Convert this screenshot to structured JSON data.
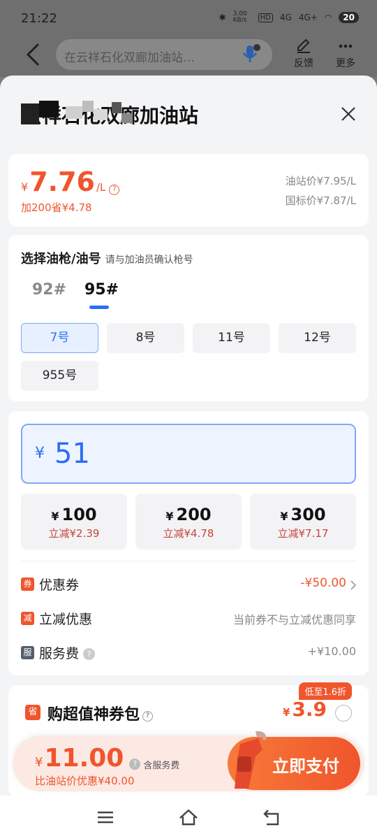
{
  "status": {
    "time": "21:22",
    "net_speed": "3.00 KB/s",
    "hd": "HD",
    "signal1": "4G",
    "signal2": "4G+",
    "battery": "20"
  },
  "header": {
    "search_text": "在云祥石化双廊加油站…",
    "feedback_label": "反馈",
    "more_label": "更多"
  },
  "station": {
    "name": "云祥石化双廊加油站"
  },
  "price": {
    "currency": "¥",
    "value": "7.76",
    "unit": "/L",
    "help": "?",
    "saving_note": "加200省¥4.78",
    "station_price": "油站价¥7.95/L",
    "national_price": "国标价¥7.87/L"
  },
  "gun": {
    "title": "选择油枪/油号",
    "hint": "请与加油员确认枪号",
    "oil_types": [
      "92#",
      "95#"
    ],
    "selected_oil": "95#",
    "guns": [
      "7号",
      "8号",
      "11号",
      "12号",
      "955号"
    ],
    "selected_gun": "7号"
  },
  "amount": {
    "currency": "¥",
    "value": "51",
    "quick": [
      {
        "amount": "100",
        "discount": "立减¥2.39"
      },
      {
        "amount": "200",
        "discount": "立减¥4.78"
      },
      {
        "amount": "300",
        "discount": "立减¥7.17"
      }
    ]
  },
  "rows": {
    "coupon": {
      "tag": "券",
      "label": "优惠券",
      "value": "-¥50.00"
    },
    "instant": {
      "tag": "减",
      "label": "立减优惠",
      "value": "当前券不与立减优惠同享"
    },
    "service": {
      "tag": "服",
      "label": "服务费",
      "value": "+¥10.00"
    }
  },
  "pack": {
    "tag": "省",
    "title": "购超值神券包",
    "badge": "低至1.6折",
    "currency": "¥",
    "price": "3.9"
  },
  "pay": {
    "currency": "¥",
    "total": "11.00",
    "note": "含服务费",
    "sub": "比油站价优惠¥40.00",
    "button_label": "立即支付"
  },
  "colors": {
    "accent": "#f0552c",
    "primary_blue": "#2a6ff5"
  }
}
